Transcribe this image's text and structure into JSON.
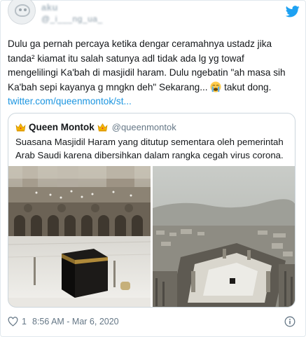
{
  "author": {
    "display_name": "aku",
    "handle": "@_i___ng_ua_"
  },
  "tweet": {
    "text_before_emoji": "Dulu ga pernah percaya ketika dengar ceramahnya ustadz jika tanda² kiamat itu salah satunya adl tidak ada lg yg towaf mengelilingi Ka'bah di masjidil haram. Dulu ngebatin \"ah masa sih Ka'bah sepi kayanya g mngkn deh\" Sekarang... ",
    "emoji_icon": "loudly-crying-face",
    "text_after_emoji": " takut dong. ",
    "link": "twitter.com/queenmontok/st..."
  },
  "quoted_tweet": {
    "name": "Queen Montok",
    "handle": "@queenmontok",
    "name_icon": "crown",
    "text": "Suasana Masjidil Haram yang ditutup sementara oleh pemerintah Arab Saudi karena dibersihkan dalam rangka cegah virus corona.",
    "media": [
      {
        "description": "kaaba-courtyard-empty"
      },
      {
        "description": "mecca-aerial-view"
      }
    ]
  },
  "footer": {
    "like_count": "1",
    "timestamp": "8:56 AM - Mar 6, 2020"
  },
  "colors": {
    "link": "#1b95e0",
    "twitter_blue": "#1da1f2",
    "muted": "#657786",
    "border": "#e1e8ed"
  }
}
